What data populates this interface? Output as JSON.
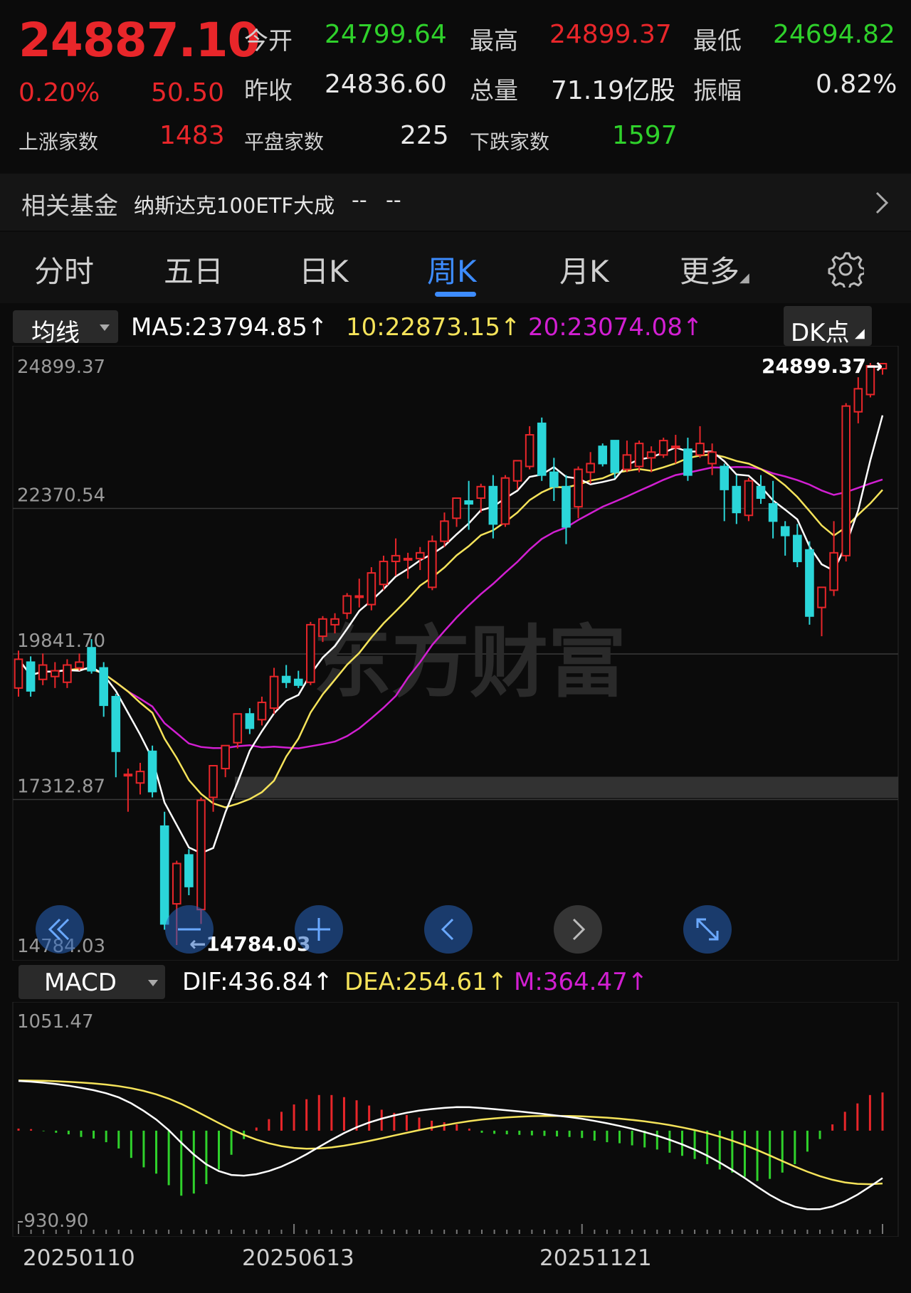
{
  "quote": {
    "price": "24887.10",
    "change_pct": "0.20%",
    "change_abs": "50.50",
    "open_label": "今开",
    "open": "24799.64",
    "high_label": "最高",
    "high": "24899.37",
    "low_label": "最低",
    "low": "24694.82",
    "prev_close_label": "昨收",
    "prev_close": "24836.60",
    "volume_label": "总量",
    "volume": "71.19亿股",
    "amplitude_label": "振幅",
    "amplitude": "0.82%",
    "up_label": "上涨家数",
    "up_count": "1483",
    "flat_label": "平盘家数",
    "flat_count": "225",
    "down_label": "下跌家数",
    "down_count": "1597"
  },
  "fund": {
    "label": "相关基金",
    "name": "纳斯达克100ETF大成",
    "value1": "--",
    "value2": "--"
  },
  "tabs": [
    "分时",
    "五日",
    "日K",
    "周K",
    "月K",
    "更多"
  ],
  "active_tab": "周K",
  "ma_bar": {
    "selector": "均线",
    "ma5": "MA5:23794.85↑",
    "ma10": "10:22873.15↑",
    "ma20": "20:23074.08↑",
    "dk_button": "DK点"
  },
  "price_axis": [
    "24899.37",
    "22370.54",
    "19841.70",
    "17312.87",
    "14784.03"
  ],
  "annotations": {
    "high_marker": "24899.37→",
    "low_marker": "←14784.03",
    "watermark": "东方财富"
  },
  "macd_bar": {
    "selector": "MACD",
    "dif": "DIF:436.84↑",
    "dea": "DEA:254.61↑",
    "m": "M:364.47↑"
  },
  "macd_axis": [
    "1051.47",
    "-930.90"
  ],
  "date_axis": [
    "20250110",
    "20250613",
    "20251121"
  ],
  "colors": {
    "up": "#e8262a",
    "down": "#2bd6d9",
    "ma5": "#ffffff",
    "ma10": "#f5e35a",
    "ma20": "#d21fd2",
    "macd_pos": "#e8262a",
    "macd_neg": "#2fd12b",
    "accent": "#3d8cff"
  },
  "nav_icons": [
    "double-left-icon",
    "zoom-out-icon",
    "zoom-in-icon",
    "left-icon",
    "right-icon",
    "expand-icon"
  ],
  "chart_data": {
    "type": "candlestick",
    "period": "weekly",
    "ylim": [
      14784.03,
      24899.37
    ],
    "candles": [
      {
        "o": 19250,
        "h": 19900,
        "l": 19100,
        "c": 19750
      },
      {
        "o": 19700,
        "h": 19800,
        "l": 19100,
        "c": 19200
      },
      {
        "o": 19400,
        "h": 19850,
        "l": 19300,
        "c": 19650
      },
      {
        "o": 19450,
        "h": 19700,
        "l": 19250,
        "c": 19550
      },
      {
        "o": 19350,
        "h": 19750,
        "l": 19250,
        "c": 19650
      },
      {
        "o": 19600,
        "h": 19850,
        "l": 19550,
        "c": 19700
      },
      {
        "o": 19950,
        "h": 20100,
        "l": 19500,
        "c": 19550
      },
      {
        "o": 19600,
        "h": 19700,
        "l": 18750,
        "c": 18950
      },
      {
        "o": 19100,
        "h": 19150,
        "l": 17700,
        "c": 18150
      },
      {
        "o": 17750,
        "h": 17850,
        "l": 17100,
        "c": 17750
      },
      {
        "o": 17600,
        "h": 17950,
        "l": 17400,
        "c": 17800
      },
      {
        "o": 18150,
        "h": 18250,
        "l": 17350,
        "c": 17450
      },
      {
        "o": 16850,
        "h": 17100,
        "l": 15050,
        "c": 15150
      },
      {
        "o": 15500,
        "h": 16250,
        "l": 14784,
        "c": 16200
      },
      {
        "o": 16350,
        "h": 16450,
        "l": 15650,
        "c": 15800
      },
      {
        "o": 15400,
        "h": 17350,
        "l": 15150,
        "c": 17300
      },
      {
        "o": 17350,
        "h": 17900,
        "l": 17100,
        "c": 17900
      },
      {
        "o": 17850,
        "h": 18250,
        "l": 17700,
        "c": 18250
      },
      {
        "o": 18300,
        "h": 18800,
        "l": 18200,
        "c": 18800
      },
      {
        "o": 18800,
        "h": 18900,
        "l": 18450,
        "c": 18550
      },
      {
        "o": 18700,
        "h": 19100,
        "l": 18600,
        "c": 19000
      },
      {
        "o": 18900,
        "h": 19600,
        "l": 18800,
        "c": 19450
      },
      {
        "o": 19450,
        "h": 19650,
        "l": 19250,
        "c": 19350
      },
      {
        "o": 19400,
        "h": 19550,
        "l": 19250,
        "c": 19300
      },
      {
        "o": 19350,
        "h": 20400,
        "l": 19300,
        "c": 20350
      },
      {
        "o": 20150,
        "h": 20500,
        "l": 20050,
        "c": 20450
      },
      {
        "o": 20350,
        "h": 20550,
        "l": 20200,
        "c": 20450
      },
      {
        "o": 20550,
        "h": 20900,
        "l": 20450,
        "c": 20850
      },
      {
        "o": 20850,
        "h": 21150,
        "l": 20650,
        "c": 20850
      },
      {
        "o": 20700,
        "h": 21350,
        "l": 20600,
        "c": 21250
      },
      {
        "o": 21050,
        "h": 21550,
        "l": 20950,
        "c": 21450
      },
      {
        "o": 21450,
        "h": 21850,
        "l": 21200,
        "c": 21550
      },
      {
        "o": 21500,
        "h": 21600,
        "l": 21150,
        "c": 21500
      },
      {
        "o": 21500,
        "h": 21700,
        "l": 21300,
        "c": 21600
      },
      {
        "o": 21000,
        "h": 21900,
        "l": 20950,
        "c": 21800
      },
      {
        "o": 21800,
        "h": 22300,
        "l": 21700,
        "c": 22150
      },
      {
        "o": 22200,
        "h": 22550,
        "l": 22050,
        "c": 22550
      },
      {
        "o": 22500,
        "h": 22850,
        "l": 22000,
        "c": 22450
      },
      {
        "o": 22550,
        "h": 22800,
        "l": 22300,
        "c": 22750
      },
      {
        "o": 22750,
        "h": 22950,
        "l": 21850,
        "c": 22100
      },
      {
        "o": 22100,
        "h": 22950,
        "l": 22050,
        "c": 22900
      },
      {
        "o": 22850,
        "h": 23200,
        "l": 22700,
        "c": 23200
      },
      {
        "o": 23100,
        "h": 23800,
        "l": 23050,
        "c": 23650
      },
      {
        "o": 23850,
        "h": 23950,
        "l": 22850,
        "c": 22950
      },
      {
        "o": 23000,
        "h": 23250,
        "l": 22500,
        "c": 22750
      },
      {
        "o": 22750,
        "h": 22950,
        "l": 21750,
        "c": 22050
      },
      {
        "o": 22400,
        "h": 23100,
        "l": 22200,
        "c": 23050
      },
      {
        "o": 23000,
        "h": 23350,
        "l": 22800,
        "c": 23150
      },
      {
        "o": 23450,
        "h": 23500,
        "l": 23100,
        "c": 23150
      },
      {
        "o": 23550,
        "h": 23550,
        "l": 22900,
        "c": 23000
      },
      {
        "o": 23050,
        "h": 23550,
        "l": 23000,
        "c": 23300
      },
      {
        "o": 23100,
        "h": 23550,
        "l": 23000,
        "c": 23500
      },
      {
        "o": 23250,
        "h": 23450,
        "l": 23000,
        "c": 23350
      },
      {
        "o": 23300,
        "h": 23600,
        "l": 23250,
        "c": 23550
      },
      {
        "o": 23450,
        "h": 23650,
        "l": 23150,
        "c": 23450
      },
      {
        "o": 23400,
        "h": 23600,
        "l": 22850,
        "c": 22950
      },
      {
        "o": 23300,
        "h": 23800,
        "l": 23250,
        "c": 23500
      },
      {
        "o": 23150,
        "h": 23500,
        "l": 22950,
        "c": 23350
      },
      {
        "o": 23100,
        "h": 23150,
        "l": 22150,
        "c": 22700
      },
      {
        "o": 22750,
        "h": 22950,
        "l": 22100,
        "c": 22300
      },
      {
        "o": 22250,
        "h": 22900,
        "l": 22150,
        "c": 22850
      },
      {
        "o": 22750,
        "h": 22950,
        "l": 22450,
        "c": 22550
      },
      {
        "o": 22450,
        "h": 22850,
        "l": 21850,
        "c": 22150
      },
      {
        "o": 22050,
        "h": 22150,
        "l": 21550,
        "c": 21900
      },
      {
        "o": 21900,
        "h": 22100,
        "l": 21350,
        "c": 21450
      },
      {
        "o": 21650,
        "h": 21800,
        "l": 20350,
        "c": 20500
      },
      {
        "o": 20650,
        "h": 20900,
        "l": 20150,
        "c": 21000
      },
      {
        "o": 20950,
        "h": 22150,
        "l": 20850,
        "c": 21600
      },
      {
        "o": 21550,
        "h": 24200,
        "l": 21450,
        "c": 24150
      },
      {
        "o": 24050,
        "h": 24650,
        "l": 23850,
        "c": 24450
      },
      {
        "o": 24350,
        "h": 24899.37,
        "l": 24300,
        "c": 24850
      },
      {
        "o": 24799.64,
        "h": 24899.37,
        "l": 24694.82,
        "c": 24887.1
      }
    ],
    "macd": {
      "ylim": [
        -930.9,
        1051.47
      ],
      "histogram": [
        20,
        15,
        -5,
        -20,
        -35,
        -60,
        -75,
        -110,
        -170,
        -260,
        -350,
        -410,
        -520,
        -620,
        -600,
        -510,
        -370,
        -230,
        -80,
        30,
        110,
        180,
        250,
        300,
        340,
        340,
        320,
        290,
        240,
        200,
        170,
        150,
        125,
        95,
        80,
        60,
        20,
        -20,
        -30,
        -35,
        -40,
        -45,
        -50,
        -55,
        -60,
        -70,
        -95,
        -110,
        -120,
        -140,
        -160,
        -180,
        -210,
        -240,
        -270,
        -320,
        -370,
        -400,
        -440,
        -480,
        -460,
        -400,
        -320,
        -200,
        -80,
        60,
        180,
        260,
        340,
        364.47
      ]
    }
  }
}
